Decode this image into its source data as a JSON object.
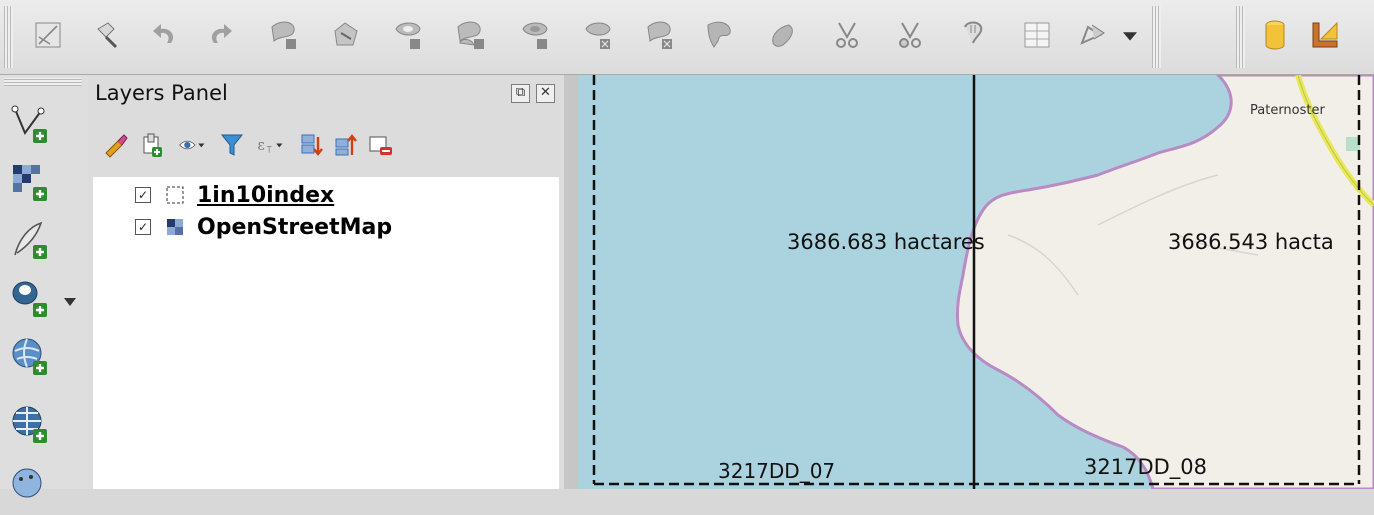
{
  "toolbar": {
    "icons": [
      "digitize-icon",
      "pan-to-selection-icon",
      "undo-icon",
      "redo-icon",
      "rotate-feature-icon",
      "simplify-feature-icon",
      "add-ring-icon",
      "add-part-icon",
      "fill-ring-icon",
      "delete-ring-icon",
      "delete-part-icon",
      "reshape-icon",
      "offset-curve-icon",
      "split-features-icon",
      "split-parts-icon",
      "merge-features-icon",
      "merge-attributes-icon",
      "node-tool-icon"
    ],
    "right_icons": [
      "database-icon",
      "measure-icon"
    ]
  },
  "left_toolbar": {
    "icons": [
      "add-vector-layer-icon",
      "add-raster-layer-icon",
      "add-delimited-text-icon",
      "add-postgis-layer-icon",
      "add-wms-layer-icon",
      "add-wcs-layer-icon",
      "add-wfs-layer-icon"
    ]
  },
  "layers_panel": {
    "title": "Layers Panel",
    "toolbar_icons": [
      "style-manager-icon",
      "add-group-icon",
      "visibility-icon",
      "filter-icon",
      "filter-expression-icon",
      "expand-all-icon",
      "collapse-all-icon",
      "remove-layer-icon"
    ],
    "layers": [
      {
        "name": "1in10index",
        "checked": true,
        "underlined": true,
        "icon": "vector-polygon-icon"
      },
      {
        "name": "OpenStreetMap",
        "checked": true,
        "underlined": false,
        "icon": "raster-icon"
      }
    ]
  },
  "map": {
    "area_labels": [
      "3686.683 hactares",
      "3686.543 hacta"
    ],
    "grid_labels": [
      "3217DD_07",
      "3217DD_08"
    ],
    "place_labels": [
      "Paternoster"
    ],
    "colors": {
      "water": "#aad3df",
      "land": "#f2efe9",
      "coast": "#b98bc4",
      "road": "#e6e85a"
    }
  }
}
